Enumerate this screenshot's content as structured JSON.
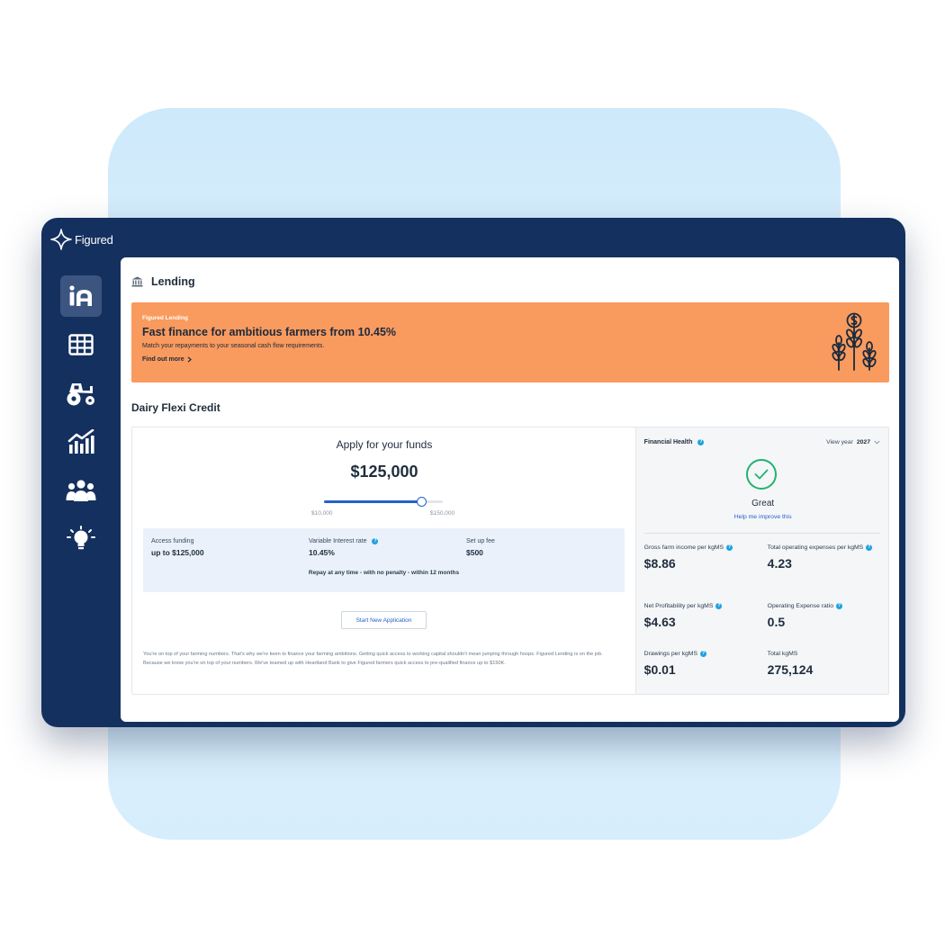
{
  "brand": {
    "name": "Figured"
  },
  "nav": [
    {
      "icon": "lending-icon",
      "active": true
    },
    {
      "icon": "grid-icon",
      "active": false
    },
    {
      "icon": "tractor-icon",
      "active": false
    },
    {
      "icon": "chart-icon",
      "active": false
    },
    {
      "icon": "people-icon",
      "active": false
    },
    {
      "icon": "lightbulb-icon",
      "active": false
    }
  ],
  "page": {
    "title": "Lending",
    "icon": "bank-icon"
  },
  "promo": {
    "eyebrow": "Figured Lending",
    "title": "Fast finance for ambitious farmers from 10.45%",
    "subtitle": "Match your repayments to your seasonal cash flow requirements.",
    "link": "Find out more",
    "background": "#f99a5e"
  },
  "section": {
    "title": "Dairy Flexi Credit"
  },
  "apply": {
    "title": "Apply for your funds",
    "amount": "$125,000",
    "slider_min_label": "$10,000",
    "slider_max_label": "$150,000",
    "slider_value": 125000,
    "slider_min": 10000,
    "slider_max": 150000,
    "terms": [
      {
        "label": "Access funding",
        "value": "up to $125,000",
        "help": false
      },
      {
        "label": "Variable Interest rate",
        "value": "10.45%",
        "help": true
      },
      {
        "label": "Set up fee",
        "value": "$500",
        "help": false
      }
    ],
    "terms_note": "Repay at any time - with no penalty - within 12 months",
    "button": "Start New Application",
    "disclaimer": "You're on top of your farming numbers. That's why we're keen to finance your farming ambitions. Getting quick access to working capital shouldn't mean jumping through hoops. Figured Lending is on the job. Because we know you're on top of your numbers. We've teamed up with Heartland Bank to give Figured farmers quick access to pre-qualified finance up to $150K."
  },
  "health": {
    "title": "Financial Health",
    "view_year_label": "View year",
    "view_year": "2027",
    "status": "Great",
    "help_link": "Help me improve this",
    "metrics": [
      {
        "label": "Gross farm income per kgMS",
        "value": "$8.86",
        "help": true
      },
      {
        "label": "Total operating expenses per kgMS",
        "value": "4.23",
        "help": true
      },
      {
        "label": "Net Profitability per kgMS",
        "value": "$4.63",
        "help": true
      },
      {
        "label": "Operating Expense ratio",
        "value": "0.5",
        "help": true
      },
      {
        "label": "Drawings per kgMS",
        "value": "$0.01",
        "help": true
      },
      {
        "label": "Total kgMS",
        "value": "275,124",
        "help": false
      }
    ]
  }
}
